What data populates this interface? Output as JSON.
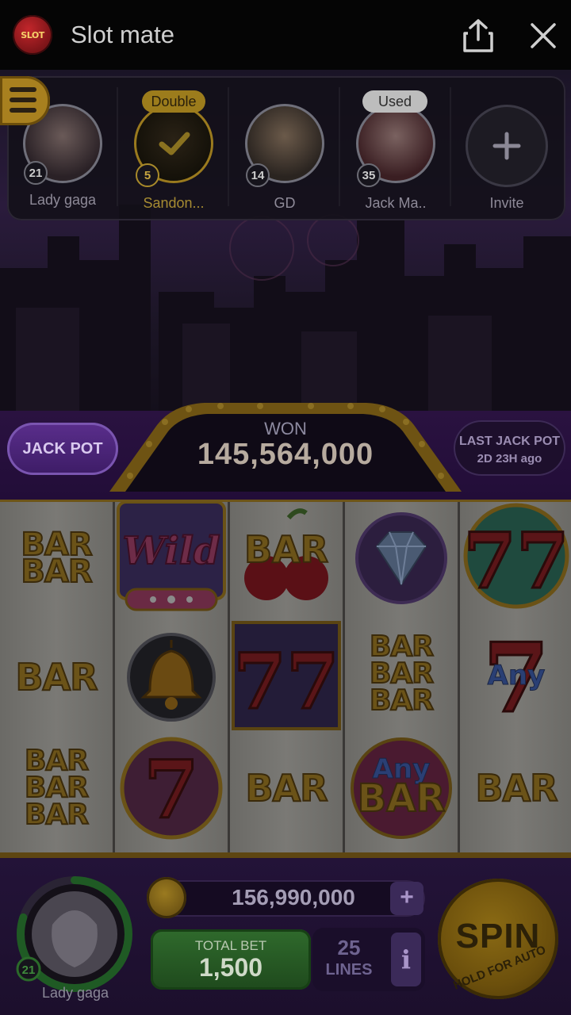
{
  "app": {
    "title": "Slot mate",
    "logo_text": "SLOT mate"
  },
  "friends": [
    {
      "name": "Lady gaga",
      "level": "21",
      "tag": "",
      "highlight": false
    },
    {
      "name": "Sandon...",
      "level": "5",
      "tag": "Double",
      "highlight": true
    },
    {
      "name": "GD",
      "level": "14",
      "tag": "",
      "highlight": false
    },
    {
      "name": "Jack Ma..",
      "level": "35",
      "tag": "Used",
      "highlight": false
    }
  ],
  "invite_label": "Invite",
  "jackpot": {
    "button_label": "JACK POT",
    "won_label": "WON",
    "won_value": "145,564,000",
    "last_label": "LAST JACK POT",
    "last_time": "2D 23H ago"
  },
  "reels": [
    [
      "BAR BAR",
      "BAR",
      "BAR BAR BAR"
    ],
    [
      "Wild",
      "bell",
      "7"
    ],
    [
      "BAR cherry",
      "77",
      "BAR"
    ],
    [
      "diamond",
      "BAR BAR BAR",
      "Any BAR"
    ],
    [
      "77",
      "Any 7",
      "BAR"
    ]
  ],
  "player": {
    "name": "Lady gaga",
    "level": "21",
    "level_progress": 0.8
  },
  "coins": {
    "value": "156,990,000",
    "plus_label": "+"
  },
  "bet": {
    "label": "TOTAL BET",
    "value": "1,500"
  },
  "lines": {
    "count": "25",
    "label": "LINES"
  },
  "info_label": "i",
  "spin": {
    "label": "SPIN",
    "sub_label": "HOLD FOR AUTO"
  },
  "colors": {
    "gold": "#a8801f",
    "purple": "#3d1c66",
    "green": "#2f6a2c"
  }
}
